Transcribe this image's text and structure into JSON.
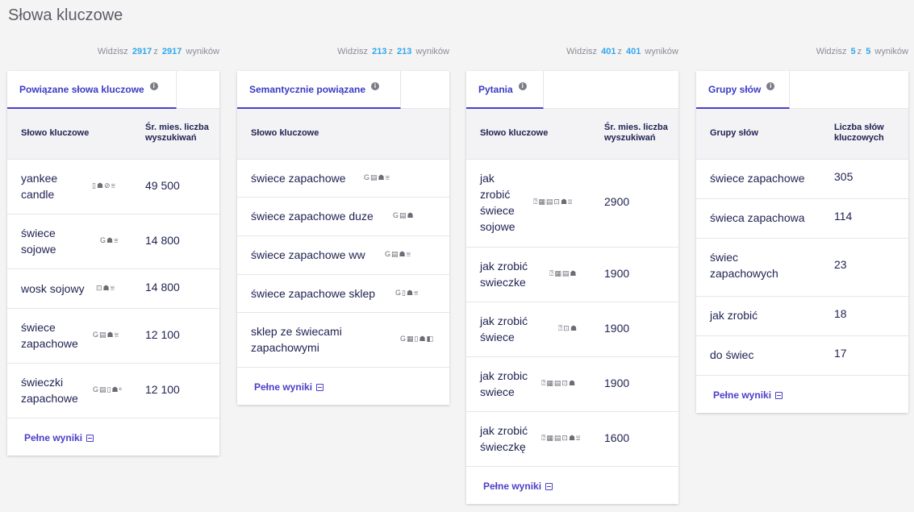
{
  "page": {
    "title": "Słowa kluczowe"
  },
  "columns": [
    {
      "count": {
        "prefix": "Widzisz",
        "shown": "2917",
        "sep": "z",
        "total": "2917",
        "suffix": "wyników"
      },
      "tab": "Powiązane słowa kluczowe",
      "header": {
        "keyword": "Słowo kluczowe",
        "value": "Śr. mies. liczba wyszukiwań"
      },
      "rows": [
        {
          "keyword": "yankee candle",
          "icons": "▯☗⊘⩸",
          "value": "49 500"
        },
        {
          "keyword": "świece sojowe",
          "icons": "G☗⩸",
          "value": "14 800"
        },
        {
          "keyword": "wosk sojowy",
          "icons": "⊡☗⩸",
          "value": "14 800"
        },
        {
          "keyword": "świece zapachowe",
          "icons": "G▤☗⩸",
          "value": "12 100"
        },
        {
          "keyword": "świeczki zapachowe",
          "icons": "G▤▯☗ᵉ",
          "value": "12 100"
        }
      ],
      "footer": "Pełne wyniki"
    },
    {
      "count": {
        "prefix": "Widzisz",
        "shown": "213",
        "sep": "z",
        "total": "213",
        "suffix": "wyników"
      },
      "tab": "Semantycznie powiązane",
      "header": {
        "keyword": "Słowo kluczowe",
        "value": ""
      },
      "rows": [
        {
          "keyword": "świece zapachowe",
          "icons": "G▤☗⩸",
          "value": ""
        },
        {
          "keyword": "świece zapachowe duze",
          "icons": "G▤☗",
          "value": ""
        },
        {
          "keyword": "świece zapachowe ww",
          "icons": "G▤☗⩸",
          "value": ""
        },
        {
          "keyword": "świece zapachowe sklep",
          "icons": "G▯☗⩸",
          "value": ""
        },
        {
          "keyword": "sklep ze świecami zapachowymi",
          "icons": "G▦▯☗◧",
          "value": ""
        }
      ],
      "footer": "Pełne wyniki"
    },
    {
      "count": {
        "prefix": "Widzisz",
        "shown": "401",
        "sep": "z",
        "total": "401",
        "suffix": "wyników"
      },
      "tab": "Pytania",
      "header": {
        "keyword": "Słowo kluczowe",
        "value": "Śr. mies. liczba wyszukiwań"
      },
      "rows": [
        {
          "keyword": "jak zrobić świece sojowe",
          "icons": "⍰▦▤⊡☗⩸",
          "value": "2900"
        },
        {
          "keyword": "jak zrobić swieczke",
          "icons": "⍰▦▤☗",
          "value": "1900"
        },
        {
          "keyword": "jak zrobić świece",
          "icons": "⍰⊡☗",
          "value": "1900"
        },
        {
          "keyword": "jak zrobic swiece",
          "icons": "⍰▦▤⊡☗",
          "value": "1900"
        },
        {
          "keyword": "jak zrobić świeczkę",
          "icons": "⍰▦▤⊡☗⩸",
          "value": "1600"
        }
      ],
      "footer": "Pełne wyniki"
    },
    {
      "count": {
        "prefix": "Widzisz",
        "shown": "5",
        "sep": "z",
        "total": "5",
        "suffix": "wyników"
      },
      "tab": "Grupy słów",
      "header": {
        "keyword": "Grupy słów",
        "value": "Liczba słów kluczowych"
      },
      "rows": [
        {
          "keyword": "świece zapachowe",
          "icons": "",
          "value": "305"
        },
        {
          "keyword": "świeca zapachowa",
          "icons": "",
          "value": "114"
        },
        {
          "keyword": "świec zapachowych",
          "icons": "",
          "value": "23"
        },
        {
          "keyword": "jak zrobić",
          "icons": "",
          "value": "18"
        },
        {
          "keyword": "do świec",
          "icons": "",
          "value": "17"
        }
      ],
      "footer": "Pełne wyniki"
    }
  ],
  "colors": {
    "accent": "#4a3fc9",
    "count_number": "#2ea7f0",
    "text": "#1e2251"
  },
  "icon_names": {
    "info": "info-icon",
    "external": "external-link-icon",
    "feature": "serp-feature-icon"
  }
}
